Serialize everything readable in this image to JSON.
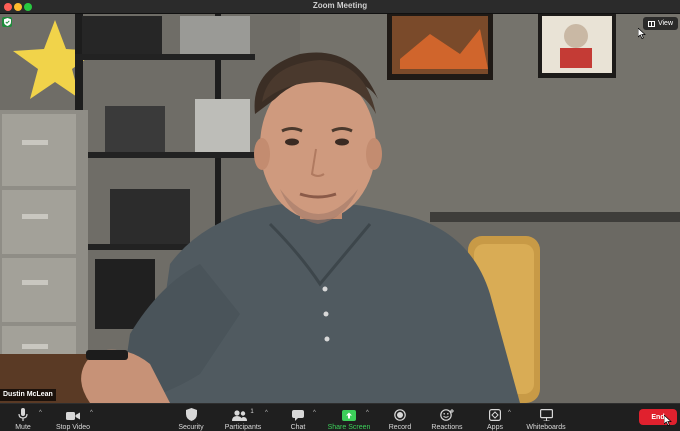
{
  "window": {
    "title": "Zoom Meeting"
  },
  "video": {
    "participant_name": "Dustin McLean",
    "view_button_label": "View",
    "security_badge_icon": "shield-check-icon"
  },
  "toolbar": {
    "mute_label": "Mute",
    "stop_video_label": "Stop Video",
    "security_label": "Security",
    "participants_label": "Participants",
    "participants_count": "1",
    "chat_label": "Chat",
    "share_screen_label": "Share Screen",
    "record_label": "Record",
    "reactions_label": "Reactions",
    "apps_label": "Apps",
    "whiteboards_label": "Whiteboards",
    "end_label": "End"
  },
  "colors": {
    "share_accent": "#3ccf5a",
    "end_button": "#e0212e",
    "toolbar_bg": "#1f1f1f"
  }
}
